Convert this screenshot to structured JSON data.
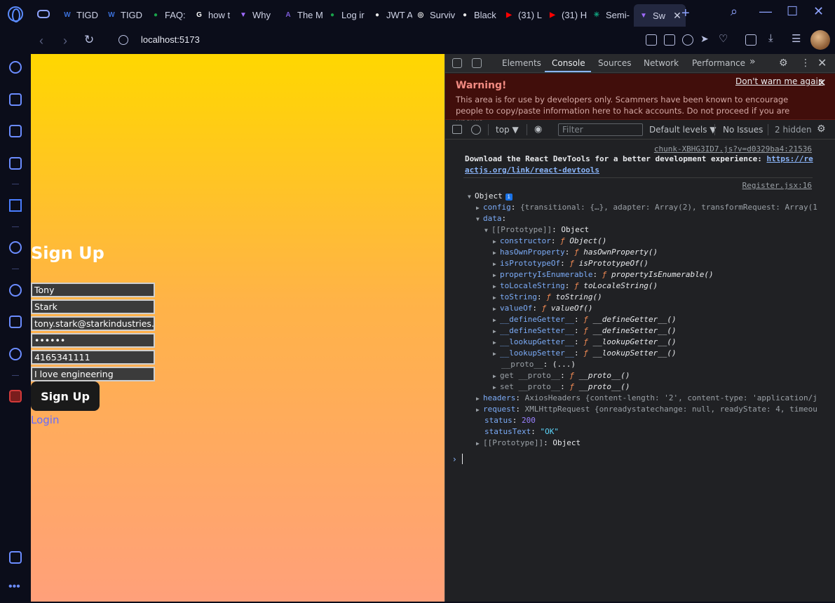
{
  "browser": {
    "tabs": [
      {
        "label": "TIGD",
        "fav_color": "#3a6fd8",
        "fav_glyph": "W"
      },
      {
        "label": "TIGD",
        "fav_color": "#3a6fd8",
        "fav_glyph": "W"
      },
      {
        "label": "FAQ:",
        "fav_color": "#19a24a",
        "fav_glyph": "●"
      },
      {
        "label": "how t",
        "fav_color": "#ffffff",
        "fav_glyph": "G"
      },
      {
        "label": "Why",
        "fav_color": "#a06bff",
        "fav_glyph": "▼"
      },
      {
        "label": "The M",
        "fav_color": "#7b5bd6",
        "fav_glyph": "A"
      },
      {
        "label": "Log ir",
        "fav_color": "#19a24a",
        "fav_glyph": "●"
      },
      {
        "label": "JWT A",
        "fav_color": "#e8e8e8",
        "fav_glyph": "●"
      },
      {
        "label": "Surviv",
        "fav_color": "#e8e8e8",
        "fav_glyph": "◎"
      },
      {
        "label": "Black",
        "fav_color": "#e8e8e8",
        "fav_glyph": "●"
      },
      {
        "label": "(31) L",
        "fav_color": "#ff0000",
        "fav_glyph": "▶"
      },
      {
        "label": "(31) H",
        "fav_color": "#ff0000",
        "fav_glyph": "▶"
      },
      {
        "label": "Semi-",
        "fav_color": "#10a37f",
        "fav_glyph": "✳"
      }
    ],
    "active_tab": {
      "label": "Sw",
      "fav_color": "#a06bff",
      "fav_glyph": "▼",
      "close": "✕"
    },
    "new_tab": "+",
    "url": "localhost:5173"
  },
  "page": {
    "title": "Sign Up",
    "fields": [
      {
        "name": "first-name",
        "value": "Tony"
      },
      {
        "name": "last-name",
        "value": "Stark"
      },
      {
        "name": "email",
        "value": "tony.stark@starkindustries.ca"
      },
      {
        "name": "password",
        "value": "••••••"
      },
      {
        "name": "phone",
        "value": "4165341111"
      },
      {
        "name": "bio",
        "value": "I love engineering"
      }
    ],
    "button_label": "Sign Up",
    "login_link": "Login"
  },
  "devtools": {
    "tabs": [
      "Elements",
      "Console",
      "Sources",
      "Network",
      "Performance"
    ],
    "more_tabs": "»",
    "active_tab": "Console",
    "warning": {
      "title": "Warning!",
      "text": "This area is for use by developers only. Scammers have been known to encourage people to copy/paste information here to hack accounts. Do not proceed if you are unsure.",
      "dismiss": "Don't warn me again"
    },
    "toolbar": {
      "context": "top ▼",
      "filter_placeholder": "Filter",
      "levels": "Default levels ▼",
      "issues": "No Issues",
      "hidden": "2 hidden"
    },
    "console": {
      "src1": "chunk-XBHG3ID7.js?v=d0329ba4:21536",
      "msg1_text": "Download the React DevTools for a better development experience: ",
      "msg1_link_a": "https://re",
      "msg1_link_b": "actjs.org/link/react-devtools",
      "src2": "Register.jsx:16",
      "object_label": "Object",
      "config_key": "config",
      "config_val": "{transitional: {…}, adapter: Array(2), transformRequest: Array(1",
      "data_key": "data",
      "proto_key": "[[Prototype]]",
      "proto_val": "Object",
      "proto_members": [
        {
          "key": "constructor",
          "fn": "Object()"
        },
        {
          "key": "hasOwnProperty",
          "fn": "hasOwnProperty()"
        },
        {
          "key": "isPrototypeOf",
          "fn": "isPrototypeOf()"
        },
        {
          "key": "propertyIsEnumerable",
          "fn": "propertyIsEnumerable()"
        },
        {
          "key": "toLocaleString",
          "fn": "toLocaleString()"
        },
        {
          "key": "toString",
          "fn": "toString()"
        },
        {
          "key": "valueOf",
          "fn": "valueOf()"
        },
        {
          "key": "__defineGetter__",
          "fn": "__defineGetter__()"
        },
        {
          "key": "__defineSetter__",
          "fn": "__defineSetter__()"
        },
        {
          "key": "__lookupGetter__",
          "fn": "__lookupGetter__()"
        },
        {
          "key": "__lookupSetter__",
          "fn": "__lookupSetter__()"
        }
      ],
      "proto_proto": "__proto__",
      "proto_proto_val": "(...)",
      "get_proto": "get __proto__",
      "set_proto": "set __proto__",
      "proto_fn": "__proto__()",
      "headers_key": "headers",
      "headers_val": "AxiosHeaders {content-length: '2', content-type: 'application/j",
      "request_key": "request",
      "request_val": "XMLHttpRequest {onreadystatechange: null, readyState: 4, timeou",
      "status_key": "status",
      "status_val": "200",
      "statustext_key": "statusText",
      "statustext_val": "\"OK\"",
      "proto2_key": "[[Prototype]]",
      "proto2_val": "Object",
      "prompt": "›"
    }
  }
}
